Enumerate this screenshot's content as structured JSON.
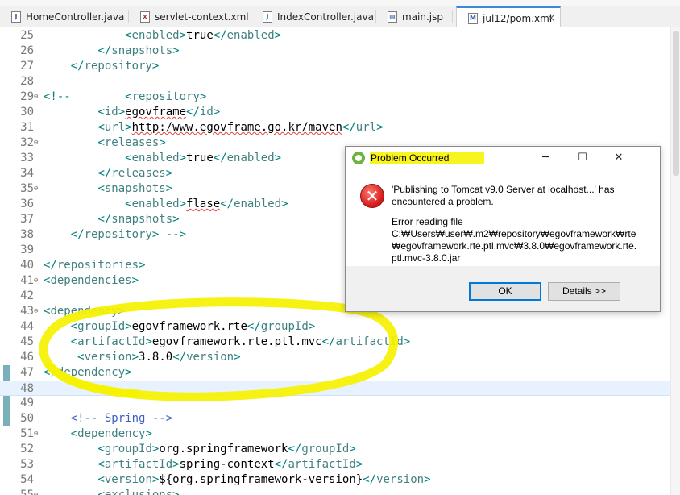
{
  "tabs": [
    {
      "label": "HomeController.java",
      "type": "java",
      "active": false
    },
    {
      "label": "servlet-context.xml",
      "type": "xml",
      "active": false
    },
    {
      "label": "IndexController.java",
      "type": "java",
      "active": false
    },
    {
      "label": "main.jsp",
      "type": "jsp",
      "active": false
    },
    {
      "label": "jul12/pom.xml",
      "type": "xml",
      "active": true,
      "close": "×"
    }
  ],
  "editor": {
    "lines": [
      {
        "n": "25",
        "fold": "",
        "html": "            <span class='b'>&lt;</span><span class='t'>enabled</span><span class='b'>&gt;</span>true<span class='b'>&lt;/</span><span class='t'>enabled</span><span class='b'>&gt;</span>"
      },
      {
        "n": "26",
        "fold": "",
        "html": "        <span class='b'>&lt;/</span><span class='t'>snapshots</span><span class='b'>&gt;</span>"
      },
      {
        "n": "27",
        "fold": "",
        "html": "    <span class='b'>&lt;/</span><span class='t'>repository</span><span class='b'>&gt;</span>"
      },
      {
        "n": "28",
        "fold": "",
        "html": ""
      },
      {
        "n": "29",
        "fold": "⊖",
        "html": "<span class='b'>&lt;!--</span>        <span class='b'>&lt;</span><span class='t'>repository</span><span class='b'>&gt;</span>"
      },
      {
        "n": "30",
        "fold": "",
        "html": "        <span class='b'>&lt;</span><span class='t'>id</span><span class='b'>&gt;</span><span class='squig'>egovframe</span><span class='b'>&lt;/</span><span class='t'>id</span><span class='b'>&gt;</span>"
      },
      {
        "n": "31",
        "fold": "",
        "html": "        <span class='b'>&lt;</span><span class='t'>url</span><span class='b'>&gt;</span><span class='squig'>http:/www.egovframe.go.kr/maven</span><span class='b'>&lt;/</span><span class='t'>url</span><span class='b'>&gt;</span>"
      },
      {
        "n": "32",
        "fold": "⊖",
        "html": "        <span class='b'>&lt;</span><span class='t'>releases</span><span class='b'>&gt;</span>"
      },
      {
        "n": "33",
        "fold": "",
        "html": "            <span class='b'>&lt;</span><span class='t'>enabled</span><span class='b'>&gt;</span>true<span class='b'>&lt;/</span><span class='t'>enabled</span><span class='b'>&gt;</span>"
      },
      {
        "n": "34",
        "fold": "",
        "html": "        <span class='b'>&lt;/</span><span class='t'>releases</span><span class='b'>&gt;</span>"
      },
      {
        "n": "35",
        "fold": "⊖",
        "html": "        <span class='b'>&lt;</span><span class='t'>snapshots</span><span class='b'>&gt;</span>"
      },
      {
        "n": "36",
        "fold": "",
        "html": "            <span class='b'>&lt;</span><span class='t'>enabled</span><span class='b'>&gt;</span><span class='squig'>flase</span><span class='b'>&lt;/</span><span class='t'>enabled</span><span class='b'>&gt;</span>"
      },
      {
        "n": "37",
        "fold": "",
        "html": "        <span class='b'>&lt;/</span><span class='t'>snapshots</span><span class='b'>&gt;</span>"
      },
      {
        "n": "38",
        "fold": "",
        "html": "    <span class='b'>&lt;/</span><span class='t'>repository</span><span class='b'>&gt; --&gt;</span>"
      },
      {
        "n": "39",
        "fold": "",
        "html": ""
      },
      {
        "n": "40",
        "fold": "",
        "html": "<span class='b'>&lt;/</span><span class='t'>repositories</span><span class='b'>&gt;</span>"
      },
      {
        "n": "41",
        "fold": "⊖",
        "html": "<span class='b'>&lt;</span><span class='t'>dependencies</span><span class='b'>&gt;</span>"
      },
      {
        "n": "42",
        "fold": "",
        "html": ""
      },
      {
        "n": "43",
        "fold": "⊖",
        "html": "<span class='b'>&lt;</span><span class='t'>dependency</span><span class='b'>&gt;</span>"
      },
      {
        "n": "44",
        "fold": "",
        "html": "    <span class='b'>&lt;</span><span class='t'>groupId</span><span class='b'>&gt;</span>egovframework.rte<span class='b'>&lt;/</span><span class='t'>groupId</span><span class='b'>&gt;</span>"
      },
      {
        "n": "45",
        "fold": "",
        "html": "    <span class='b'>&lt;</span><span class='t'>artifactId</span><span class='b'>&gt;</span>egovframework.rte.ptl.mvc<span class='b'>&lt;/</span><span class='t'>artifactId</span><span class='b'>&gt;</span>"
      },
      {
        "n": "46",
        "fold": "",
        "html": "     <span class='b'>&lt;</span><span class='t'>version</span><span class='b'>&gt;</span>3.8.0<span class='b'>&lt;/</span><span class='t'>version</span><span class='b'>&gt;</span>"
      },
      {
        "n": "47",
        "fold": "",
        "html": "<span class='b'>&lt;/</span><span class='t'>dependency</span><span class='b'>&gt;</span>"
      },
      {
        "n": "48",
        "fold": "",
        "html": ""
      },
      {
        "n": "49",
        "fold": "",
        "html": ""
      },
      {
        "n": "50",
        "fold": "",
        "html": "    <span class='c'>&lt;!-- Spring --&gt;</span>"
      },
      {
        "n": "51",
        "fold": "⊖",
        "html": "    <span class='b'>&lt;</span><span class='t'>dependency</span><span class='b'>&gt;</span>"
      },
      {
        "n": "52",
        "fold": "",
        "html": "        <span class='b'>&lt;</span><span class='t'>groupId</span><span class='b'>&gt;</span>org.springframework<span class='b'>&lt;/</span><span class='t'>groupId</span><span class='b'>&gt;</span>"
      },
      {
        "n": "53",
        "fold": "",
        "html": "        <span class='b'>&lt;</span><span class='t'>artifactId</span><span class='b'>&gt;</span>spring-context<span class='b'>&lt;/</span><span class='t'>artifactId</span><span class='b'>&gt;</span>"
      },
      {
        "n": "54",
        "fold": "",
        "html": "        <span class='b'>&lt;</span><span class='t'>version</span><span class='b'>&gt;</span>${org.springframework-version}<span class='b'>&lt;/</span><span class='t'>version</span><span class='b'>&gt;</span>"
      },
      {
        "n": "55",
        "fold": "⊖",
        "html": "        <span class='b'>&lt;</span><span class='t'>exclusions</span><span class='b'>&gt;</span>"
      }
    ],
    "current_line": "48"
  },
  "dialog": {
    "title": "Problem Occurred",
    "minimize": "─",
    "maximize": "☐",
    "close": "✕",
    "error_icon": "error-x-icon",
    "error_glyph": "✕",
    "message": "'Publishing to Tomcat v9.0 Server at localhost...' has encountered a problem.",
    "detail_heading": "Error reading file",
    "detail_path": "C:₩Users₩user₩.m2₩repository₩egovframework₩rte₩egovframework.rte.ptl.mvc₩3.8.0₩egovframework.rte.ptl.mvc-3.8.0.jar",
    "ok_label": "OK",
    "details_label": "Details >>"
  },
  "colors": {
    "highlighter": "#f5f200",
    "tag": "#3f7f7f",
    "bracket": "#008080",
    "comment": "#3f5fbf",
    "accent": "#0078d7"
  }
}
